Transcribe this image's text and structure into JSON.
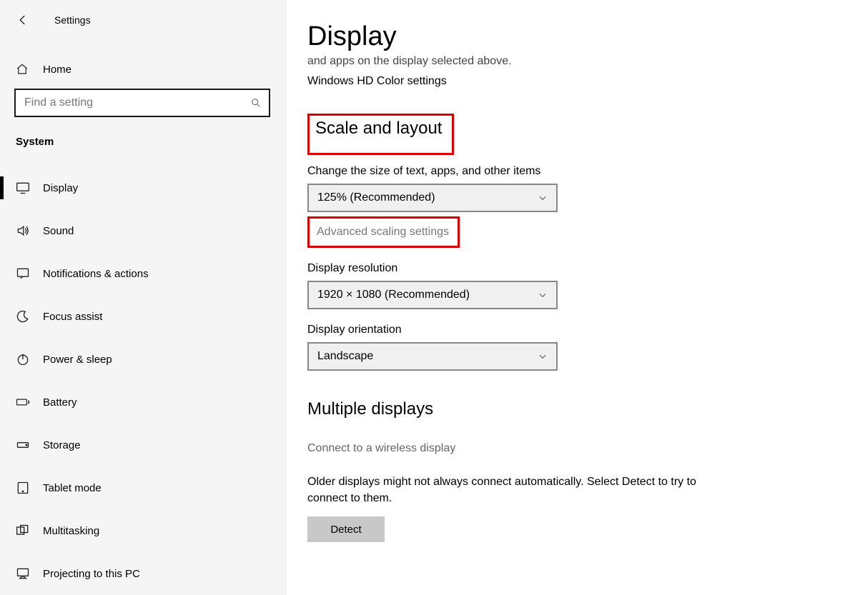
{
  "header": {
    "title": "Settings"
  },
  "home": {
    "label": "Home"
  },
  "search": {
    "placeholder": "Find a setting"
  },
  "category": "System",
  "nav": [
    {
      "label": "Display"
    },
    {
      "label": "Sound"
    },
    {
      "label": "Notifications & actions"
    },
    {
      "label": "Focus assist"
    },
    {
      "label": "Power & sleep"
    },
    {
      "label": "Battery"
    },
    {
      "label": "Storage"
    },
    {
      "label": "Tablet mode"
    },
    {
      "label": "Multitasking"
    },
    {
      "label": "Projecting to this PC"
    }
  ],
  "page": {
    "title": "Display",
    "clipped": "and apps on the display selected above.",
    "hd_link": "Windows HD Color settings",
    "scale_heading": "Scale and layout",
    "scale_label": "Change the size of text, apps, and other items",
    "scale_value": "125% (Recommended)",
    "adv_link": "Advanced scaling settings",
    "res_label": "Display resolution",
    "res_value": "1920 × 1080 (Recommended)",
    "orient_label": "Display orientation",
    "orient_value": "Landscape",
    "multi_heading": "Multiple displays",
    "connect_link": "Connect to a wireless display",
    "help_text": "Older displays might not always connect automatically. Select Detect to try to connect to them.",
    "detect_label": "Detect"
  }
}
